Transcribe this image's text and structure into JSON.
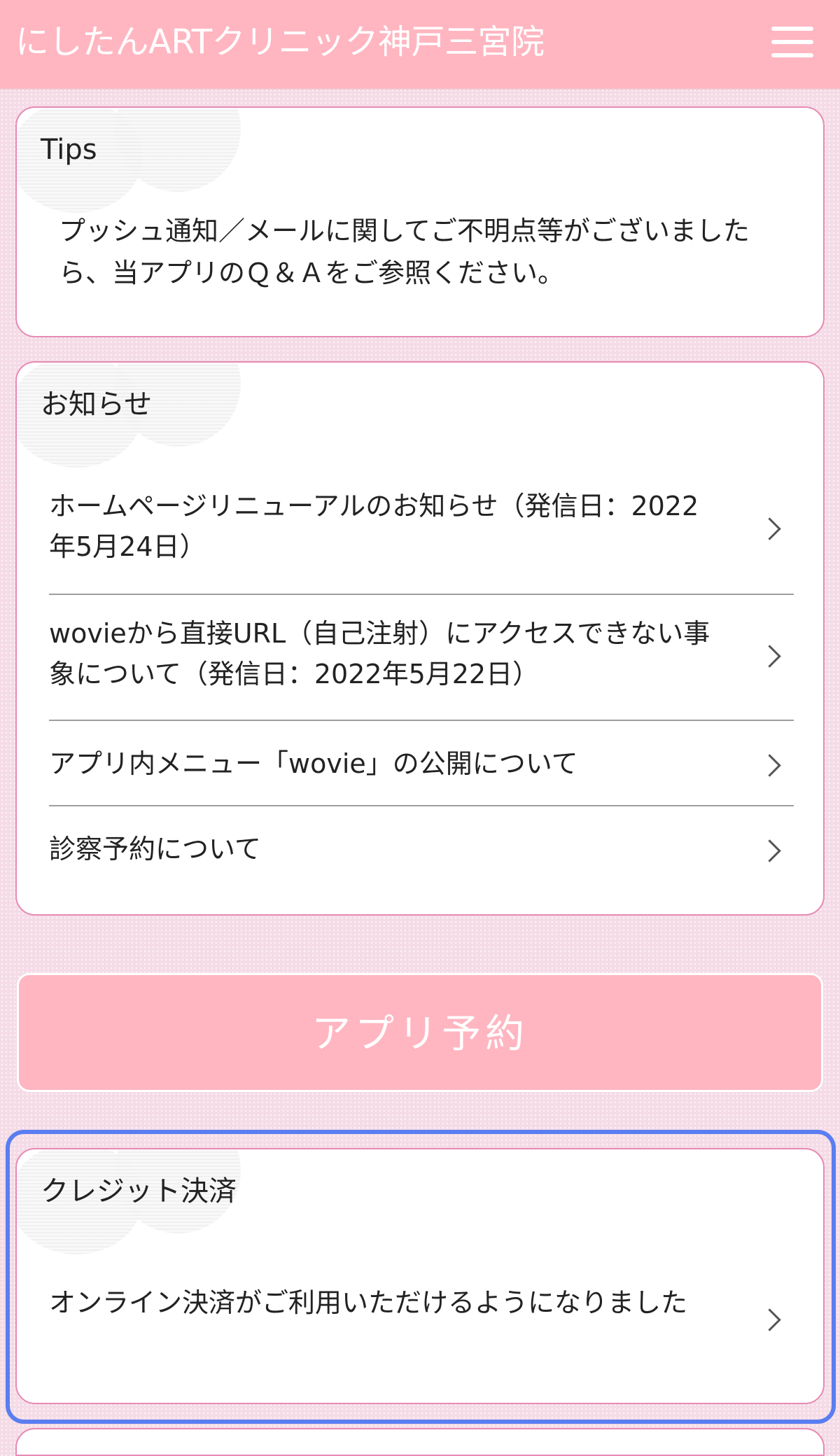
{
  "header": {
    "title": "にしたんARTクリニック神戸三宮院",
    "menu_icon": "hamburger-menu-icon"
  },
  "tips": {
    "title": "Tips",
    "text": "プッシュ通知／メールに関してご不明点等がございましたら、当アプリのＱ＆Ａをご参照ください。"
  },
  "news": {
    "title": "お知らせ",
    "items": [
      {
        "label": "ホームページリニューアルのお知らせ（発信日：2022年5月24日）"
      },
      {
        "label": "wovieから直接URL（自己注射）にアクセスできない事象について（発信日：2022年5月22日）"
      },
      {
        "label": "アプリ内メニュー「wovie」の公開について"
      },
      {
        "label": "診察予約について"
      }
    ]
  },
  "reserve": {
    "label": "アプリ予約"
  },
  "credit": {
    "title": "クレジット決済",
    "items": [
      {
        "label": "オンライン決済がご利用いただけるようになりました"
      }
    ]
  },
  "colors": {
    "header_bg": "#ffb6c1",
    "card_border": "#e68ab4",
    "focus_ring": "#5a7ef0"
  }
}
